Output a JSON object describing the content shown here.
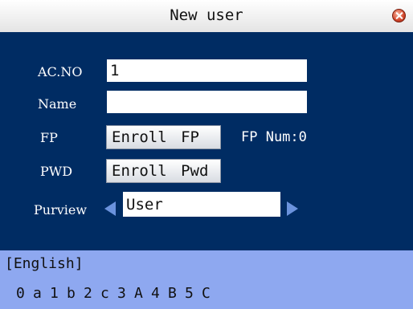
{
  "window": {
    "title": "New user",
    "close_icon": "close-icon"
  },
  "form": {
    "acno_label": "AC.NO",
    "acno_value": "1",
    "name_label": "Name",
    "name_value": "",
    "fp_label": "FP",
    "fp_button": "Enroll FP",
    "fp_num": "FP Num:0",
    "pwd_label": "PWD",
    "pwd_button": "Enroll Pwd",
    "purview_label": "Purview",
    "purview_value": "User",
    "arrow_left_icon": "left-arrow-icon",
    "arrow_right_icon": "right-arrow-icon"
  },
  "ime": {
    "language": "[English]",
    "chars": [
      "0",
      "a",
      "1",
      "b",
      "2",
      "c",
      "3",
      "A",
      "4",
      "B",
      "5",
      "C"
    ]
  },
  "colors": {
    "main_bg": "#002c63",
    "ime_bg": "#8ea8f0",
    "arrow": "#6b93dd"
  }
}
